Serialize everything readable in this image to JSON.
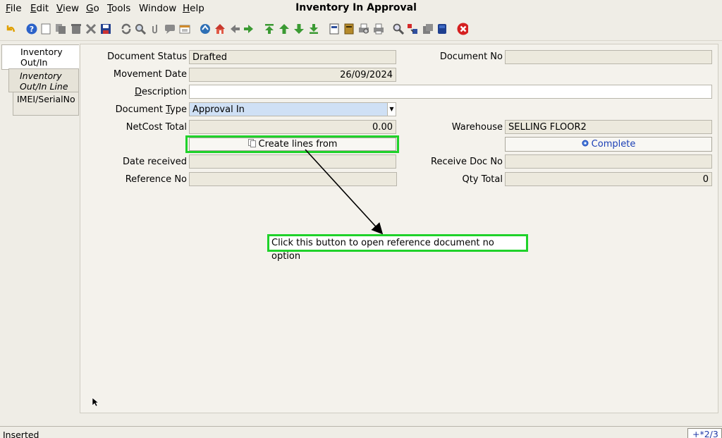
{
  "menu": {
    "items": [
      {
        "label": "File",
        "mnemonic": "F",
        "rest": "ile"
      },
      {
        "label": "Edit",
        "mnemonic": "E",
        "rest": "dit"
      },
      {
        "label": "View",
        "mnemonic": "V",
        "rest": "iew"
      },
      {
        "label": "Go",
        "mnemonic": "G",
        "rest": "o"
      },
      {
        "label": "Tools",
        "mnemonic": "T",
        "rest": "ools"
      },
      {
        "label": "Window",
        "mnemonic": "",
        "rest": "Window"
      },
      {
        "label": "Help",
        "mnemonic": "H",
        "rest": "elp"
      }
    ]
  },
  "window": {
    "title": "Inventory In Approval"
  },
  "toolbar": {
    "icons": [
      "undo-icon",
      "help-icon",
      "new-icon",
      "copy-icon",
      "delete-icon",
      "delete-selection-icon",
      "save-icon",
      "refresh-icon",
      "find-icon",
      "attachment-icon",
      "chat-icon",
      "history-icon",
      "home-icon",
      "back-icon",
      "forward-icon",
      "first-record-icon",
      "previous-record-icon",
      "next-record-icon",
      "last-record-icon",
      "report-icon",
      "archive-icon",
      "print-preview-icon",
      "print-icon",
      "zoom-across-icon",
      "request-icon",
      "product-info-icon",
      "workflow-icon",
      "end-icon"
    ]
  },
  "tabs": [
    {
      "label_line1": "Inventory",
      "label_line2": "Out/In"
    },
    {
      "label_line1": "Inventory",
      "label_line2": "Out/In Line"
    },
    {
      "label_line1": "IMEI/SerialNo",
      "label_line2": ""
    }
  ],
  "form": {
    "document_status": {
      "label": "Document Status",
      "value": "Drafted"
    },
    "document_no": {
      "label": "Document No",
      "value": ""
    },
    "movement_date": {
      "label": "Movement Date",
      "value": "26/09/2024"
    },
    "description": {
      "label": "Description",
      "mnemonic": "D",
      "rest": "escription",
      "value": ""
    },
    "document_type": {
      "label": "Document Type",
      "mnemonic": "T",
      "before": "Document ",
      "rest": "ype",
      "value": "Approval In"
    },
    "netcost_total": {
      "label": "NetCost Total",
      "value": "0.00"
    },
    "warehouse": {
      "label": "Warehouse",
      "value": "SELLING FLOOR2"
    },
    "create_lines_from": {
      "label": "Create lines from"
    },
    "complete": {
      "label": "Complete"
    },
    "date_received": {
      "label": "Date received",
      "value": ""
    },
    "receive_doc_no": {
      "label": "Receive Doc No",
      "value": ""
    },
    "reference_no": {
      "label": "Reference No",
      "value": ""
    },
    "qty_total": {
      "label": "Qty Total",
      "value": "0"
    }
  },
  "annotation": {
    "text": "Click this button to open reference document no option"
  },
  "status": {
    "text": "Inserted",
    "record_nav": "+*2/3"
  },
  "colors": {
    "highlight": "#1fd22a",
    "accent": "#1b3fb6"
  }
}
